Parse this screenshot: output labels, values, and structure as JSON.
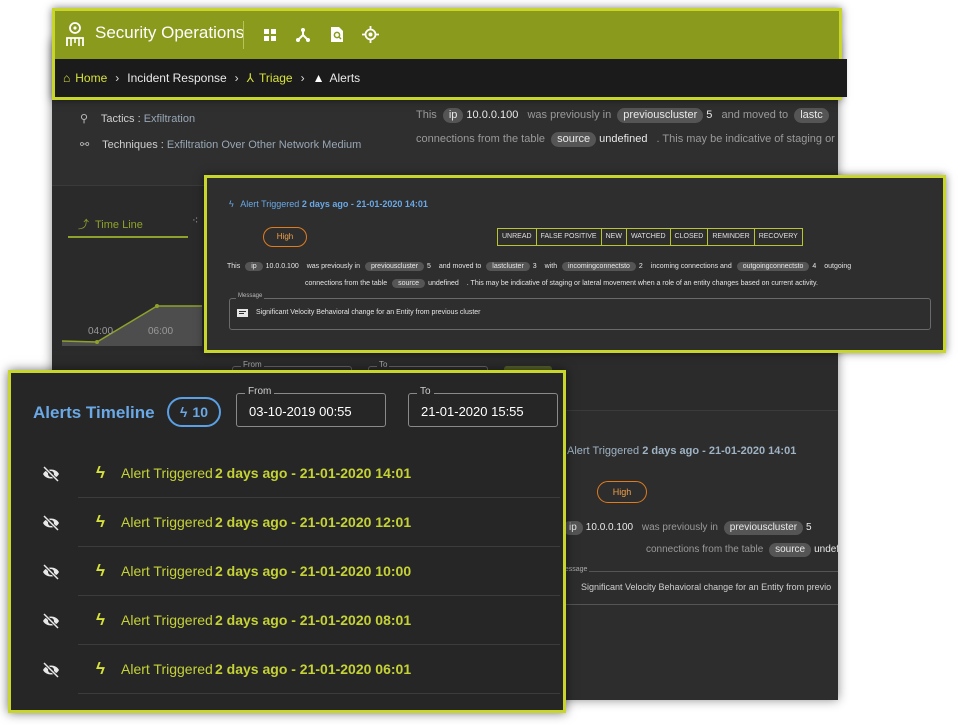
{
  "app": {
    "title": "Security Operations",
    "accent": "#c8d62c",
    "header_color": "#8a9a1c"
  },
  "toolbar": {
    "icons": [
      "grid-icon",
      "network-icon",
      "document-search-icon",
      "target-icon"
    ]
  },
  "breadcrumb": {
    "home": "Home",
    "incident": "Incident Response",
    "triage": "Triage",
    "alerts": "Alerts"
  },
  "background": {
    "tactics_label": "Tactics : ",
    "tactics_value": "Exfiltration",
    "techniques_label": "Techniques : ",
    "techniques_value": "Exfiltration Over Other Network Medium",
    "summary": {
      "this": "This",
      "ip_tag": "ip",
      "ip_value": "10.0.0.100",
      "was_prev": "was previously in",
      "prev_tag": "previouscluster",
      "prev_value": "5",
      "moved_to": "and moved to",
      "last_tag_partial": "lastc",
      "connections_from": "connections from the table",
      "source_tag": "source",
      "source_value": "undefined",
      "indicative_partial": ". This may be indicative of staging or"
    },
    "timeline_tab": "Time Line",
    "axis_ticks": [
      "04:00",
      "06:00"
    ],
    "lower_alert": {
      "prefix": "Alert Triggered",
      "when": "2 days ago - 21-01-2020 14:01",
      "severity": "High",
      "was_prev": "was previously in",
      "connections_from": "connections from the table",
      "source_value_partial": "undefi",
      "message_label": "Message",
      "message_partial": "Significant Velocity Behavioral change for an Entity from previo"
    }
  },
  "alert_card": {
    "prefix": "Alert Triggered",
    "when": "2 days ago - 21-01-2020 14:01",
    "severity": "High",
    "statuses": [
      "UNREAD",
      "FALSE POSITIVE",
      "NEW",
      "WATCHED",
      "CLOSED",
      "REMINDER",
      "RECOVERY"
    ],
    "line1": {
      "this": "This",
      "ip_tag": "ip",
      "ip_value": "10.0.0.100",
      "was_prev": "was previously in",
      "prev_tag": "previouscluster",
      "prev_value": "5",
      "moved_to": "and moved to",
      "last_tag": "lastcluster",
      "last_value": "3",
      "with": "with",
      "inc_tag": "incomingconnectsto",
      "inc_value": "2",
      "inc_text": "incoming connections and",
      "out_tag": "outgoingconnectsto",
      "out_value": "4",
      "out_text": "outgoing"
    },
    "line2": {
      "connections_from": "connections from the table",
      "source_tag": "source",
      "source_value": "undefined",
      "rest": ". This may be indicative of staging or lateral movement when a role of an entity changes based on current activity."
    },
    "message_label": "Message",
    "message": "Significant Velocity Behavioral change for an Entity from previous cluster"
  },
  "timeline": {
    "title": "Alerts Timeline",
    "count": "10",
    "from_label": "From",
    "from_value": "03-10-2019 00:55",
    "to_label": "To",
    "to_value": "21-01-2020 15:55",
    "items": [
      {
        "prefix": "Alert Triggered",
        "when": "2 days ago - 21-01-2020 14:01"
      },
      {
        "prefix": "Alert Triggered",
        "when": "2 days ago - 21-01-2020 12:01"
      },
      {
        "prefix": "Alert Triggered",
        "when": "2 days ago - 21-01-2020 10:00"
      },
      {
        "prefix": "Alert Triggered",
        "when": "2 days ago - 21-01-2020 08:01"
      },
      {
        "prefix": "Alert Triggered",
        "when": "2 days ago - 21-01-2020 06:01"
      }
    ]
  }
}
